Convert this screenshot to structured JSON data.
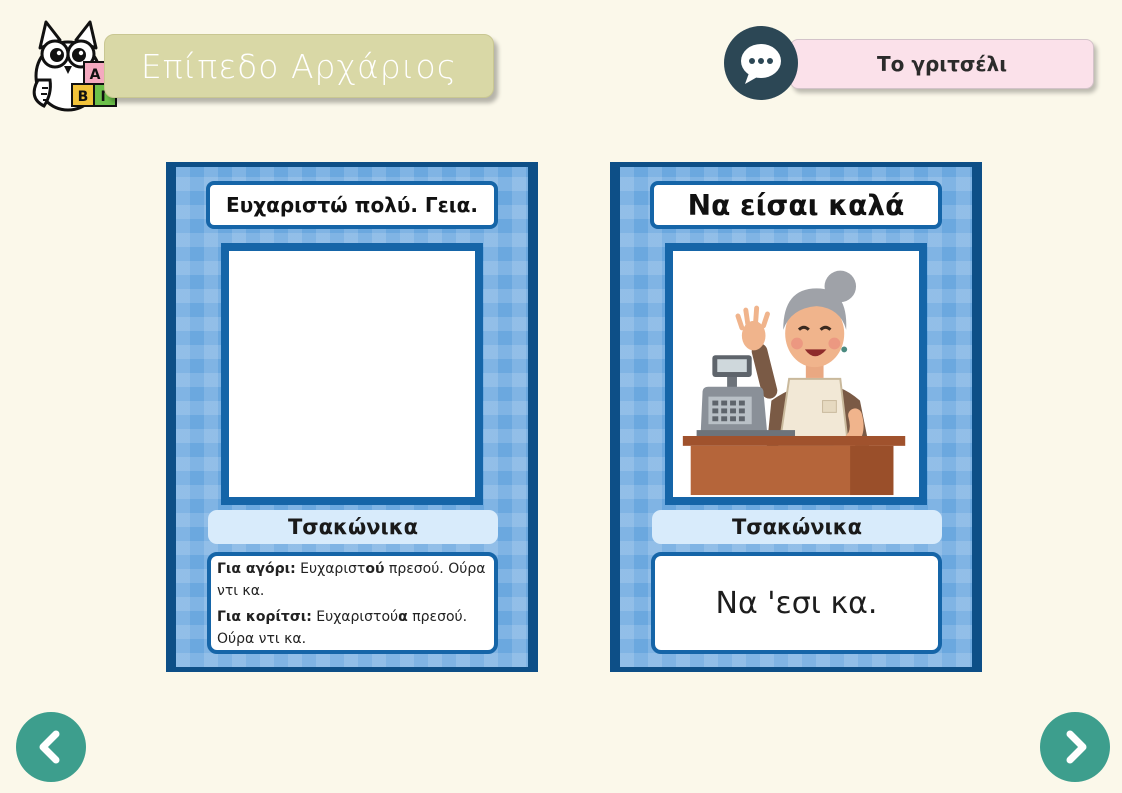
{
  "header": {
    "level_label": "Επίπεδο Αρχάριος",
    "logo_blocks": [
      "Α",
      "Β",
      "Γ"
    ],
    "topic_label": "Το γριτσέλι"
  },
  "cards": [
    {
      "title": "Ευχαριστώ πολύ. Γεια.",
      "language_label": "Τσακώνικα",
      "translations": [
        {
          "label": "Για αγόρι:",
          "pre": "Ευχαριστ",
          "stress": "ού",
          "post": " πρεσού. Ούρα ντι κα."
        },
        {
          "label": "Για κορίτσι:",
          "pre": "Ευχαριστού",
          "stress": "α",
          "post": " πρεσού. Ούρα ντι κα."
        }
      ]
    },
    {
      "title": "Να είσαι καλά",
      "language_label": "Τσακώνικα",
      "translation": "Να 'εσι κα."
    }
  ],
  "icons": {
    "chat": "chat-bubble-icon",
    "prev": "chevron-left-icon",
    "next": "chevron-right-icon"
  },
  "colors": {
    "background": "#fbf8ea",
    "card_border": "#0d4f87",
    "card_fill": "#6ba8df",
    "nav": "#3d9e8d",
    "chat": "#2c4755"
  }
}
